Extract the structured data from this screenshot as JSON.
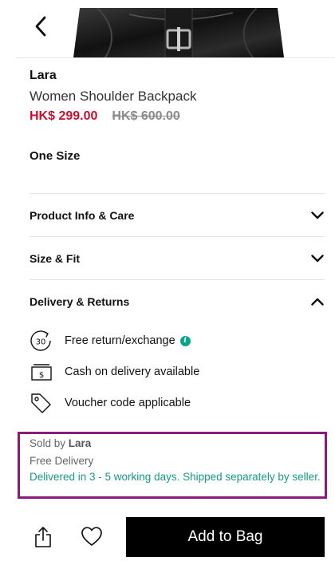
{
  "header": {
    "back_icon": "chevron-left-icon",
    "hero_image": "black backpack product photo"
  },
  "product": {
    "brand": "Lara",
    "name": "Women Shoulder Backpack",
    "price": "HK$ 299.00",
    "original_price": "HK$ 600.00",
    "size": "One Size"
  },
  "accordion": [
    {
      "title": "Product Info & Care",
      "state": "collapsed",
      "icon": "chevron-down-icon"
    },
    {
      "title": "Size & Fit",
      "state": "collapsed",
      "icon": "chevron-down-icon"
    },
    {
      "title": "Delivery & Returns",
      "state": "expanded",
      "icon": "chevron-up-icon"
    }
  ],
  "delivery_features": [
    {
      "icon": "30-day-return-icon",
      "icon_text": "30",
      "label": "Free return/exchange",
      "info_icon": "info-icon"
    },
    {
      "icon": "cash-icon",
      "icon_text": "$",
      "label": "Cash on delivery available"
    },
    {
      "icon": "tag-icon",
      "label": "Voucher code applicable"
    }
  ],
  "seller": {
    "sold_by_prefix": "Sold by",
    "seller_name": "Lara",
    "free_delivery": "Free Delivery",
    "delivery_time": "Delivered in 3 - 5 working days. Shipped separately by seller."
  },
  "bottom_bar": {
    "share_icon": "share-icon",
    "wishlist_icon": "heart-icon",
    "add_to_bag": "Add to Bag"
  },
  "colors": {
    "sale_price": "#c8102e",
    "accent_teal": "#159a84",
    "highlight_border": "#8b1a7a",
    "button_bg": "#000000"
  }
}
